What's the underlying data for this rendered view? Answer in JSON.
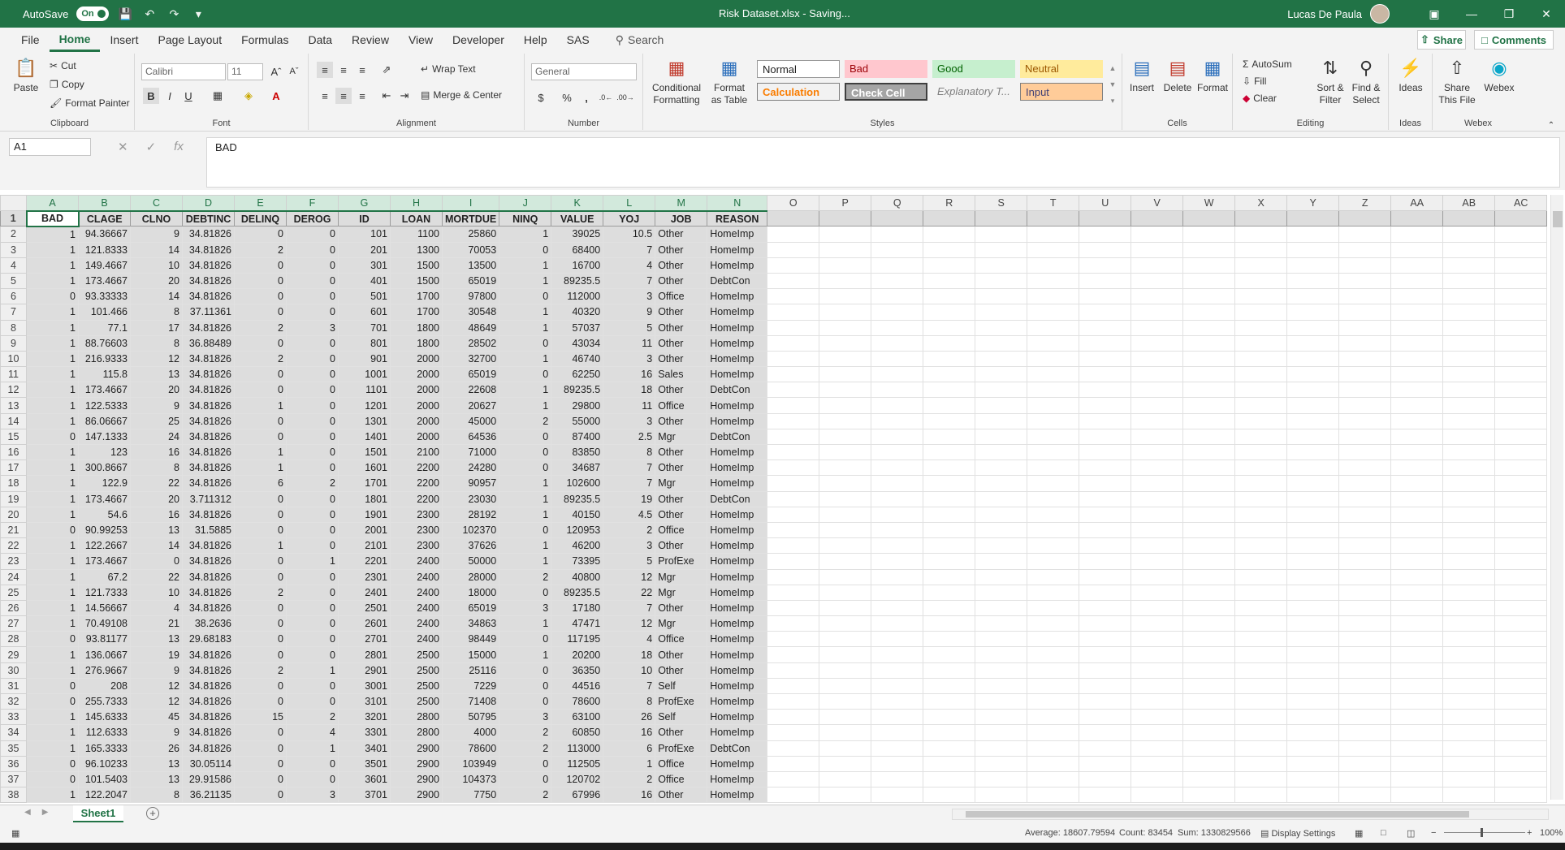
{
  "titlebar": {
    "autosave_label": "AutoSave",
    "autosave_state": "On",
    "title": "Risk Dataset.xlsx  -  Saving...",
    "user": "Lucas De Paula"
  },
  "menu": {
    "tabs": [
      "File",
      "Home",
      "Insert",
      "Page Layout",
      "Formulas",
      "Data",
      "Review",
      "View",
      "Developer",
      "Help",
      "SAS"
    ],
    "search": "Search",
    "share": "Share",
    "comments": "Comments"
  },
  "ribbon": {
    "clipboard": {
      "label": "Clipboard",
      "paste": "Paste",
      "cut": "Cut",
      "copy": "Copy",
      "format_painter": "Format Painter"
    },
    "font": {
      "label": "Font",
      "name": "Calibri",
      "size": "11"
    },
    "alignment": {
      "label": "Alignment",
      "wrap_text": "Wrap Text",
      "merge_center": "Merge & Center"
    },
    "number": {
      "label": "Number",
      "format": "General"
    },
    "styles": {
      "label": "Styles",
      "conditional_formatting": "Conditional Formatting",
      "format_as_table": "Format as Table",
      "normal": "Normal",
      "bad": "Bad",
      "good": "Good",
      "neutral": "Neutral",
      "calculation": "Calculation",
      "check_cell": "Check Cell",
      "explanatory": "Explanatory T...",
      "input": "Input"
    },
    "cells": {
      "label": "Cells",
      "insert": "Insert",
      "delete": "Delete",
      "format": "Format"
    },
    "editing": {
      "label": "Editing",
      "autosum": "AutoSum",
      "fill": "Fill",
      "clear": "Clear",
      "sort_filter": "Sort & Filter",
      "find_select": "Find & Select"
    },
    "ideas": {
      "label": "Ideas",
      "ideas": "Ideas"
    },
    "webex": {
      "label": "Webex",
      "share_file": "Share This File",
      "webex": "Webex"
    }
  },
  "formula_bar": {
    "name_box": "A1",
    "content": "BAD"
  },
  "sheet": {
    "columns": [
      "A",
      "B",
      "C",
      "D",
      "E",
      "F",
      "G",
      "H",
      "I",
      "J",
      "K",
      "L",
      "M",
      "N",
      "O",
      "P",
      "Q",
      "R",
      "S",
      "T",
      "U",
      "V",
      "W",
      "X",
      "Y",
      "Z",
      "AA",
      "AB",
      "AC"
    ],
    "headers": [
      "BAD",
      "CLAGE",
      "CLNO",
      "DEBTINC",
      "DELINQ",
      "DEROG",
      "ID",
      "LOAN",
      "MORTDUE",
      "NINQ",
      "VALUE",
      "YOJ",
      "JOB",
      "REASON"
    ],
    "rows": [
      [
        "1",
        "94.36667",
        "9",
        "34.81826",
        "0",
        "0",
        "101",
        "1100",
        "25860",
        "1",
        "39025",
        "10.5",
        "Other",
        "HomeImp"
      ],
      [
        "1",
        "121.8333",
        "14",
        "34.81826",
        "2",
        "0",
        "201",
        "1300",
        "70053",
        "0",
        "68400",
        "7",
        "Other",
        "HomeImp"
      ],
      [
        "1",
        "149.4667",
        "10",
        "34.81826",
        "0",
        "0",
        "301",
        "1500",
        "13500",
        "1",
        "16700",
        "4",
        "Other",
        "HomeImp"
      ],
      [
        "1",
        "173.4667",
        "20",
        "34.81826",
        "0",
        "0",
        "401",
        "1500",
        "65019",
        "1",
        "89235.5",
        "7",
        "Other",
        "DebtCon"
      ],
      [
        "0",
        "93.33333",
        "14",
        "34.81826",
        "0",
        "0",
        "501",
        "1700",
        "97800",
        "0",
        "112000",
        "3",
        "Office",
        "HomeImp"
      ],
      [
        "1",
        "101.466",
        "8",
        "37.11361",
        "0",
        "0",
        "601",
        "1700",
        "30548",
        "1",
        "40320",
        "9",
        "Other",
        "HomeImp"
      ],
      [
        "1",
        "77.1",
        "17",
        "34.81826",
        "2",
        "3",
        "701",
        "1800",
        "48649",
        "1",
        "57037",
        "5",
        "Other",
        "HomeImp"
      ],
      [
        "1",
        "88.76603",
        "8",
        "36.88489",
        "0",
        "0",
        "801",
        "1800",
        "28502",
        "0",
        "43034",
        "11",
        "Other",
        "HomeImp"
      ],
      [
        "1",
        "216.9333",
        "12",
        "34.81826",
        "2",
        "0",
        "901",
        "2000",
        "32700",
        "1",
        "46740",
        "3",
        "Other",
        "HomeImp"
      ],
      [
        "1",
        "115.8",
        "13",
        "34.81826",
        "0",
        "0",
        "1001",
        "2000",
        "65019",
        "0",
        "62250",
        "16",
        "Sales",
        "HomeImp"
      ],
      [
        "1",
        "173.4667",
        "20",
        "34.81826",
        "0",
        "0",
        "1101",
        "2000",
        "22608",
        "1",
        "89235.5",
        "18",
        "Other",
        "DebtCon"
      ],
      [
        "1",
        "122.5333",
        "9",
        "34.81826",
        "1",
        "0",
        "1201",
        "2000",
        "20627",
        "1",
        "29800",
        "11",
        "Office",
        "HomeImp"
      ],
      [
        "1",
        "86.06667",
        "25",
        "34.81826",
        "0",
        "0",
        "1301",
        "2000",
        "45000",
        "2",
        "55000",
        "3",
        "Other",
        "HomeImp"
      ],
      [
        "0",
        "147.1333",
        "24",
        "34.81826",
        "0",
        "0",
        "1401",
        "2000",
        "64536",
        "0",
        "87400",
        "2.5",
        "Mgr",
        "DebtCon"
      ],
      [
        "1",
        "123",
        "16",
        "34.81826",
        "1",
        "0",
        "1501",
        "2100",
        "71000",
        "0",
        "83850",
        "8",
        "Other",
        "HomeImp"
      ],
      [
        "1",
        "300.8667",
        "8",
        "34.81826",
        "1",
        "0",
        "1601",
        "2200",
        "24280",
        "0",
        "34687",
        "7",
        "Other",
        "HomeImp"
      ],
      [
        "1",
        "122.9",
        "22",
        "34.81826",
        "6",
        "2",
        "1701",
        "2200",
        "90957",
        "1",
        "102600",
        "7",
        "Mgr",
        "HomeImp"
      ],
      [
        "1",
        "173.4667",
        "20",
        "3.711312",
        "0",
        "0",
        "1801",
        "2200",
        "23030",
        "1",
        "89235.5",
        "19",
        "Other",
        "DebtCon"
      ],
      [
        "1",
        "54.6",
        "16",
        "34.81826",
        "0",
        "0",
        "1901",
        "2300",
        "28192",
        "1",
        "40150",
        "4.5",
        "Other",
        "HomeImp"
      ],
      [
        "0",
        "90.99253",
        "13",
        "31.5885",
        "0",
        "0",
        "2001",
        "2300",
        "102370",
        "0",
        "120953",
        "2",
        "Office",
        "HomeImp"
      ],
      [
        "1",
        "122.2667",
        "14",
        "34.81826",
        "1",
        "0",
        "2101",
        "2300",
        "37626",
        "1",
        "46200",
        "3",
        "Other",
        "HomeImp"
      ],
      [
        "1",
        "173.4667",
        "0",
        "34.81826",
        "0",
        "1",
        "2201",
        "2400",
        "50000",
        "1",
        "73395",
        "5",
        "ProfExe",
        "HomeImp"
      ],
      [
        "1",
        "67.2",
        "22",
        "34.81826",
        "0",
        "0",
        "2301",
        "2400",
        "28000",
        "2",
        "40800",
        "12",
        "Mgr",
        "HomeImp"
      ],
      [
        "1",
        "121.7333",
        "10",
        "34.81826",
        "2",
        "0",
        "2401",
        "2400",
        "18000",
        "0",
        "89235.5",
        "22",
        "Mgr",
        "HomeImp"
      ],
      [
        "1",
        "14.56667",
        "4",
        "34.81826",
        "0",
        "0",
        "2501",
        "2400",
        "65019",
        "3",
        "17180",
        "7",
        "Other",
        "HomeImp"
      ],
      [
        "1",
        "70.49108",
        "21",
        "38.2636",
        "0",
        "0",
        "2601",
        "2400",
        "34863",
        "1",
        "47471",
        "12",
        "Mgr",
        "HomeImp"
      ],
      [
        "0",
        "93.81177",
        "13",
        "29.68183",
        "0",
        "0",
        "2701",
        "2400",
        "98449",
        "0",
        "117195",
        "4",
        "Office",
        "HomeImp"
      ],
      [
        "1",
        "136.0667",
        "19",
        "34.81826",
        "0",
        "0",
        "2801",
        "2500",
        "15000",
        "1",
        "20200",
        "18",
        "Other",
        "HomeImp"
      ],
      [
        "1",
        "276.9667",
        "9",
        "34.81826",
        "2",
        "1",
        "2901",
        "2500",
        "25116",
        "0",
        "36350",
        "10",
        "Other",
        "HomeImp"
      ],
      [
        "0",
        "208",
        "12",
        "34.81826",
        "0",
        "0",
        "3001",
        "2500",
        "7229",
        "0",
        "44516",
        "7",
        "Self",
        "HomeImp"
      ],
      [
        "0",
        "255.7333",
        "12",
        "34.81826",
        "0",
        "0",
        "3101",
        "2500",
        "71408",
        "0",
        "78600",
        "8",
        "ProfExe",
        "HomeImp"
      ],
      [
        "1",
        "145.6333",
        "45",
        "34.81826",
        "15",
        "2",
        "3201",
        "2800",
        "50795",
        "3",
        "63100",
        "26",
        "Self",
        "HomeImp"
      ],
      [
        "1",
        "112.6333",
        "9",
        "34.81826",
        "0",
        "4",
        "3301",
        "2800",
        "4000",
        "2",
        "60850",
        "16",
        "Other",
        "HomeImp"
      ],
      [
        "1",
        "165.3333",
        "26",
        "34.81826",
        "0",
        "1",
        "3401",
        "2900",
        "78600",
        "2",
        "113000",
        "6",
        "ProfExe",
        "DebtCon"
      ],
      [
        "0",
        "96.10233",
        "13",
        "30.05114",
        "0",
        "0",
        "3501",
        "2900",
        "103949",
        "0",
        "112505",
        "1",
        "Office",
        "HomeImp"
      ],
      [
        "0",
        "101.5403",
        "13",
        "29.91586",
        "0",
        "0",
        "3601",
        "2900",
        "104373",
        "0",
        "120702",
        "2",
        "Office",
        "HomeImp"
      ],
      [
        "1",
        "122.2047",
        "8",
        "36.21135",
        "0",
        "3",
        "3701",
        "2900",
        "7750",
        "2",
        "67996",
        "16",
        "Other",
        "HomeImp"
      ]
    ]
  },
  "tabs": {
    "sheet1": "Sheet1"
  },
  "status": {
    "average": "Average: 18607.79594",
    "count": "Count: 83454",
    "sum": "Sum: 1330829566",
    "display_settings": "Display Settings",
    "zoom": "100%"
  }
}
